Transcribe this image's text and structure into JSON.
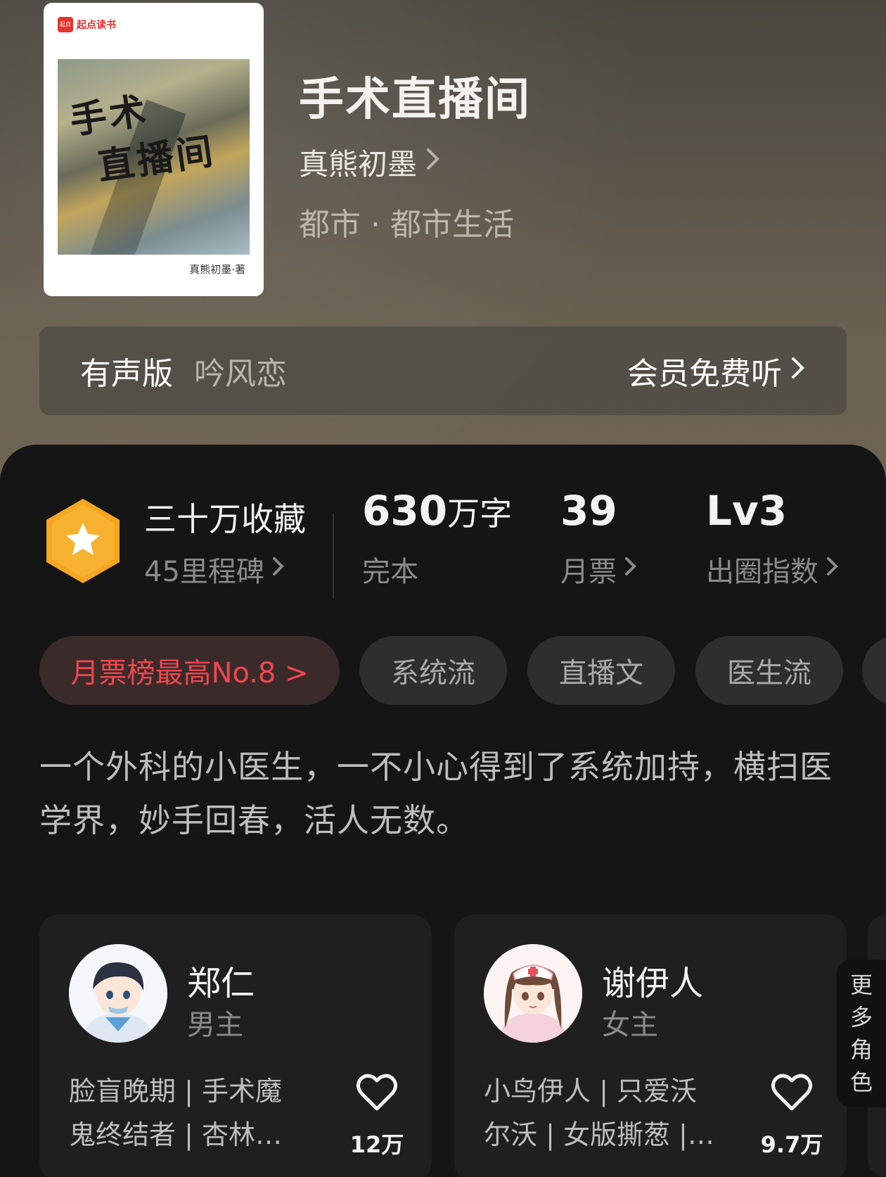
{
  "book": {
    "cover_brand": "起点读书",
    "cover_brand_mark": "起点",
    "cover_title_line1": "手术",
    "cover_title_line2": "直播间",
    "cover_author": "真熊初墨·著",
    "title": "手术直播间",
    "author": "真熊初墨",
    "genre": "都市 · 都市生活"
  },
  "audio": {
    "label": "有声版",
    "narrator": "吟风恋",
    "cta": "会员免费听"
  },
  "stats": {
    "favorites": "三十万收藏",
    "milestones": "45里程碑",
    "word_count_num": "630",
    "word_count_unit": "万字",
    "status": "完本",
    "monthly_votes": "39",
    "monthly_votes_label": "月票",
    "level": "Lv3",
    "level_label": "出圈指数"
  },
  "tags": [
    {
      "label": "月票榜最高No.8 >"
    },
    {
      "label": "系统流"
    },
    {
      "label": "直播文"
    },
    {
      "label": "医生流"
    }
  ],
  "synopsis": "一个外科的小医生，一不小心得到了系统加持，横扫医学界，妙手回春，活人无数。",
  "characters": [
    {
      "name": "郑仁",
      "role": "男主",
      "desc": "脸盲晚期 | 手术魔鬼终结者 | 杏林…",
      "likes": "12万"
    },
    {
      "name": "谢伊人",
      "role": "女主",
      "desc": "小鸟伊人 | 只爱沃尔沃 | 女版撕葱 |…",
      "likes": "9.7万"
    }
  ],
  "more_roles": [
    "更",
    "多",
    "角",
    "色"
  ],
  "colors": {
    "accent_red": "#f0464f",
    "badge_orange": "#f5a623"
  },
  "icons": {
    "chevron": "chevron-right-icon",
    "badge": "star-hexagon-icon",
    "heart": "heart-outline-icon"
  }
}
